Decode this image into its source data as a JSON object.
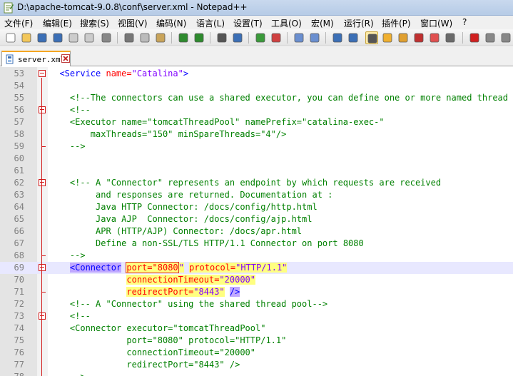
{
  "window": {
    "title": "D:\\apache-tomcat-9.0.8\\conf\\server.xml - Notepad++"
  },
  "menu": [
    "文件(F)",
    "编辑(E)",
    "搜索(S)",
    "视图(V)",
    "编码(N)",
    "语言(L)",
    "设置(T)",
    "工具(O)",
    "宏(M)",
    "运行(R)",
    "插件(P)",
    "窗口(W)",
    "?"
  ],
  "toolbar_icons": [
    "new-file-icon",
    "open-file-icon",
    "save-icon",
    "save-all-icon",
    "close-icon",
    "close-all-icon",
    "print-icon",
    "cut-icon",
    "copy-icon",
    "paste-icon",
    "undo-icon",
    "redo-icon",
    "find-icon",
    "replace-icon",
    "zoom-in-icon",
    "zoom-out-icon",
    "sync-vertical-icon",
    "sync-horizontal-icon",
    "word-wrap-icon",
    "show-all-chars-icon",
    "indent-guide-icon",
    "user-language-icon",
    "doc-map-icon",
    "function-list-icon",
    "folder-workspace-icon",
    "monitor-icon",
    "record-macro-icon",
    "stop-macro-icon",
    "play-macro-icon",
    "run-macro-multiple-icon",
    "save-macro-icon"
  ],
  "tab": {
    "label": "server.xml"
  },
  "editor": {
    "lines": [
      {
        "n": "53",
        "parts": [
          [
            "  ",
            "p"
          ],
          [
            "<Service",
            "tg"
          ],
          [
            " name=",
            "at"
          ],
          [
            "\"Catalina\"",
            "vl"
          ],
          [
            ">",
            "tg"
          ]
        ]
      },
      {
        "n": "54",
        "parts": []
      },
      {
        "n": "55",
        "parts": [
          [
            "    ",
            "p"
          ],
          [
            "<!--The connectors can use a shared executor, you can define one or more named thread pools-->",
            "cm"
          ]
        ]
      },
      {
        "n": "56",
        "parts": [
          [
            "    ",
            "p"
          ],
          [
            "<!--",
            "cm"
          ]
        ]
      },
      {
        "n": "57",
        "parts": [
          [
            "    ",
            "p"
          ],
          [
            "<Executor name=\"tomcatThreadPool\" namePrefix=\"catalina-exec-\"",
            "cm"
          ]
        ]
      },
      {
        "n": "58",
        "parts": [
          [
            "        ",
            "p"
          ],
          [
            "maxThreads=\"150\" minSpareThreads=\"4\"/>",
            "cm"
          ]
        ]
      },
      {
        "n": "59",
        "parts": [
          [
            "    ",
            "p"
          ],
          [
            "-->",
            "cm"
          ]
        ]
      },
      {
        "n": "60",
        "parts": []
      },
      {
        "n": "61",
        "parts": []
      },
      {
        "n": "62",
        "parts": [
          [
            "    ",
            "p"
          ],
          [
            "<!-- A \"Connector\" represents an endpoint by which requests are received",
            "cm"
          ]
        ]
      },
      {
        "n": "63",
        "parts": [
          [
            "         ",
            "p"
          ],
          [
            "and responses are returned. Documentation at :",
            "cm"
          ]
        ]
      },
      {
        "n": "64",
        "parts": [
          [
            "         ",
            "p"
          ],
          [
            "Java HTTP Connector: /docs/config/http.html",
            "cm"
          ]
        ]
      },
      {
        "n": "65",
        "parts": [
          [
            "         ",
            "p"
          ],
          [
            "Java AJP  Connector: /docs/config/ajp.html",
            "cm"
          ]
        ]
      },
      {
        "n": "66",
        "parts": [
          [
            "         ",
            "p"
          ],
          [
            "APR (HTTP/AJP) Connector: /docs/apr.html",
            "cm"
          ]
        ]
      },
      {
        "n": "67",
        "parts": [
          [
            "         ",
            "p"
          ],
          [
            "Define a non-SSL/TLS HTTP/1.1 Connector on port 8080",
            "cm"
          ]
        ]
      },
      {
        "n": "68",
        "parts": [
          [
            "    ",
            "p"
          ],
          [
            "-->",
            "cm"
          ]
        ]
      },
      {
        "n": "69",
        "parts": [
          [
            "    ",
            "p"
          ],
          [
            "<Connector",
            "tg hm"
          ],
          [
            " ",
            "p"
          ],
          [
            "port=\"8080",
            "at hl brk"
          ],
          [
            "",
            "caret"
          ],
          [
            "\"",
            "vl hl"
          ],
          [
            " ",
            "p"
          ],
          [
            "protocol=",
            "at hl"
          ],
          [
            "\"HTTP/1.1\"",
            "vl hl"
          ]
        ]
      },
      {
        "n": "70",
        "parts": [
          [
            "               ",
            "p"
          ],
          [
            "connectionTimeout=",
            "at hl"
          ],
          [
            "\"20000\"",
            "vl hl"
          ]
        ]
      },
      {
        "n": "71",
        "parts": [
          [
            "               ",
            "p"
          ],
          [
            "redirectPort=",
            "at hl"
          ],
          [
            "\"8443\"",
            "vl hl"
          ],
          [
            " ",
            "p"
          ],
          [
            "/>",
            "tg hm"
          ]
        ]
      },
      {
        "n": "72",
        "parts": [
          [
            "    ",
            "p"
          ],
          [
            "<!-- A \"Connector\" using the shared thread pool-->",
            "cm"
          ]
        ]
      },
      {
        "n": "73",
        "parts": [
          [
            "    ",
            "p"
          ],
          [
            "<!--",
            "cm"
          ]
        ]
      },
      {
        "n": "74",
        "parts": [
          [
            "    ",
            "p"
          ],
          [
            "<Connector executor=\"tomcatThreadPool\"",
            "cm"
          ]
        ]
      },
      {
        "n": "75",
        "parts": [
          [
            "               ",
            "p"
          ],
          [
            "port=\"8080\" protocol=\"HTTP/1.1\"",
            "cm"
          ]
        ]
      },
      {
        "n": "76",
        "parts": [
          [
            "               ",
            "p"
          ],
          [
            "connectionTimeout=\"20000\"",
            "cm"
          ]
        ]
      },
      {
        "n": "77",
        "parts": [
          [
            "               ",
            "p"
          ],
          [
            "redirectPort=\"8443\" />",
            "cm"
          ]
        ]
      },
      {
        "n": "78",
        "parts": [
          [
            "    ",
            "p"
          ],
          [
            "-->",
            "cm"
          ]
        ]
      }
    ]
  }
}
